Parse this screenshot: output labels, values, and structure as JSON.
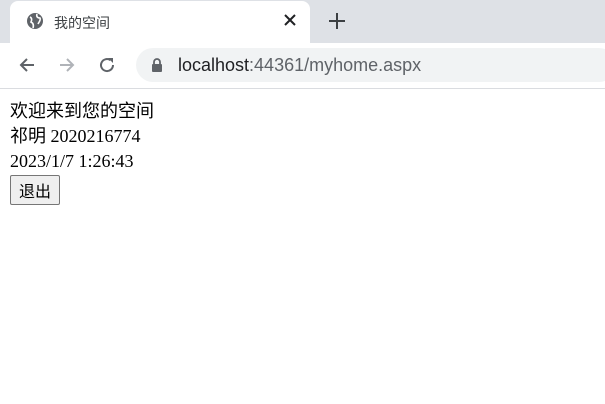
{
  "browser": {
    "tab_title": "我的空间",
    "url_host": "localhost",
    "url_rest": ":44361/myhome.aspx",
    "icons": {
      "favicon": "globe-icon",
      "close": "close-icon",
      "new_tab": "plus-icon",
      "back": "arrow-left-icon",
      "forward": "arrow-right-icon",
      "reload": "reload-icon",
      "lock": "lock-icon"
    }
  },
  "page": {
    "welcome": "欢迎来到您的空间",
    "user_name": "祁明",
    "user_id": "2020216774",
    "datetime": "2023/1/7 1:26:43",
    "logout_label": "退出"
  }
}
